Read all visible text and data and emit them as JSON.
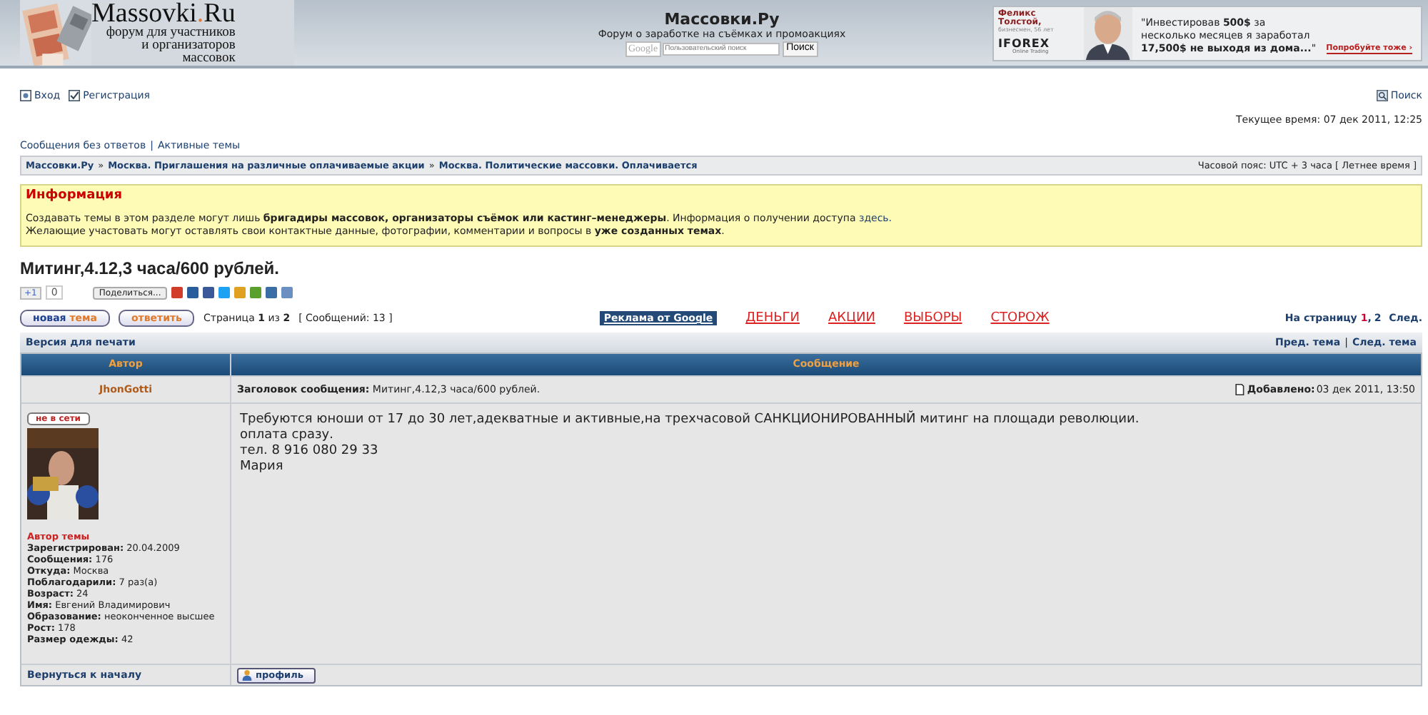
{
  "header": {
    "logo": {
      "name_start": "Massovki",
      "dot": ".",
      "name_end": "Ru",
      "tagline": [
        "форум для участников",
        "и организаторов",
        "массовок"
      ]
    },
    "site_title": "Массовки.Ру",
    "site_subtitle": "Форум о заработке на съёмках и промоакциях",
    "search": {
      "placeholder": "Пользовательский поиск",
      "brand": "Google",
      "button": "Поиск"
    },
    "ad": {
      "person": "Феликс Толстой,",
      "person_note": "бизнесмен, 56 лет",
      "broker": "IFOREX",
      "broker_note": "Online Trading",
      "quote": "\"Инвестировав **500$** за несколько месяцев я заработал **17,500$ не выходя из дома...**\"",
      "cta": "Попробуйте тоже ›"
    }
  },
  "user_links": [
    "Вход",
    "Регистрация"
  ],
  "search_link": "Поиск",
  "current_time": "Текущее время: 07 дек 2011, 12:25",
  "quick_links": [
    "Сообщения без ответов",
    "Активные темы"
  ],
  "link_separator": "|",
  "crumb_separator": "»",
  "breadcrumbs": [
    "Массовки.Ру",
    "Москва. Приглашения на различные оплачиваемые акции",
    "Москва. Политические массовки. Оплачивается"
  ],
  "timezone": "Часовой пояс: UTC + 3 часа [ Летнее время ]",
  "info": {
    "title": "Информация",
    "lines": [
      "Создавать темы в этом разделе могут лишь **бригадиры массовок, организаторы съёмок или кастинг–менеджеры**. Информация о получении доступа ",
      "Желающие участовать могут оставлять свои контактные данные, фотографии, комментарии и вопросы в **уже созданных темах**."
    ],
    "link": "здесь."
  },
  "topic_title": "Митинг,4.12,3 часа/600 рублей.",
  "share": {
    "plus_label": "+1",
    "plus_count": "0",
    "share_button": "Поделиться...",
    "services": [
      {
        "color": "#d23c2a"
      },
      {
        "color": "#2a5d9e"
      },
      {
        "color": "#3b5998"
      },
      {
        "color": "#1da1f2"
      },
      {
        "color": "#e0a020"
      },
      {
        "color": "#5aa02c"
      },
      {
        "color": "#3a6ea5"
      },
      {
        "color": "#6a8fc0"
      }
    ]
  },
  "actions": [
    {
      "words": [
        "новая",
        "тема"
      ]
    },
    {
      "words": [
        "ответить"
      ]
    }
  ],
  "pagination": {
    "page_info": "Страница **1** из **2**",
    "count": "[ Сообщений: 13 ]",
    "goto": "На страницу",
    "page_separator": ",",
    "pages": [
      {
        "label": "1",
        "selected": true
      },
      {
        "label": "2",
        "selected": false
      }
    ],
    "next": "След."
  },
  "google_ads": {
    "label": "Реклама от Google",
    "links": [
      "ДЕНЬГИ",
      "АКЦИИ",
      "ВЫБОРЫ",
      "СТОРОЖ"
    ]
  },
  "print_link": "Версия для печати",
  "topic_nav": [
    "Пред. тема",
    "След. тема"
  ],
  "topic_nav_separator": "|",
  "table": {
    "columns": [
      "Автор",
      "Сообщение"
    ],
    "post": {
      "author": "JhonGotti",
      "subject_label": "Заголовок сообщения:",
      "subject": "Митинг,4.12,3 часа/600 рублей.",
      "posted_label": "Добавлено:",
      "posted": "03 дек 2011, 13:50",
      "online": false,
      "status_text": "не в сети",
      "rank": "Автор темы",
      "profile": [
        {
          "label": "Зарегистрирован:",
          "value": "20.04.2009"
        },
        {
          "label": "Сообщения:",
          "value": "176"
        },
        {
          "label": "Откуда:",
          "value": "Москва"
        },
        {
          "label": "Поблагодарили:",
          "value": "7 раз(а)"
        },
        {
          "label": "Возраст:",
          "value": "24"
        },
        {
          "label": "Имя:",
          "value": "Евгений Владимирович"
        },
        {
          "label": "Образование:",
          "value": "неоконченное высшее"
        },
        {
          "label": "Рост:",
          "value": "178"
        },
        {
          "label": "Размер одежды:",
          "value": "42"
        }
      ],
      "body": [
        "Требуются юноши от 17 до 30 лет,адекватные и активные,на трехчасовой САНКЦИОНИРОВАННЫЙ митинг на площади революции.",
        "оплата сразу.",
        "тел. 8 916 080 29 33",
        "Мария"
      ],
      "back_to_top": "Вернуться к началу",
      "profile_button": "профиль"
    }
  }
}
